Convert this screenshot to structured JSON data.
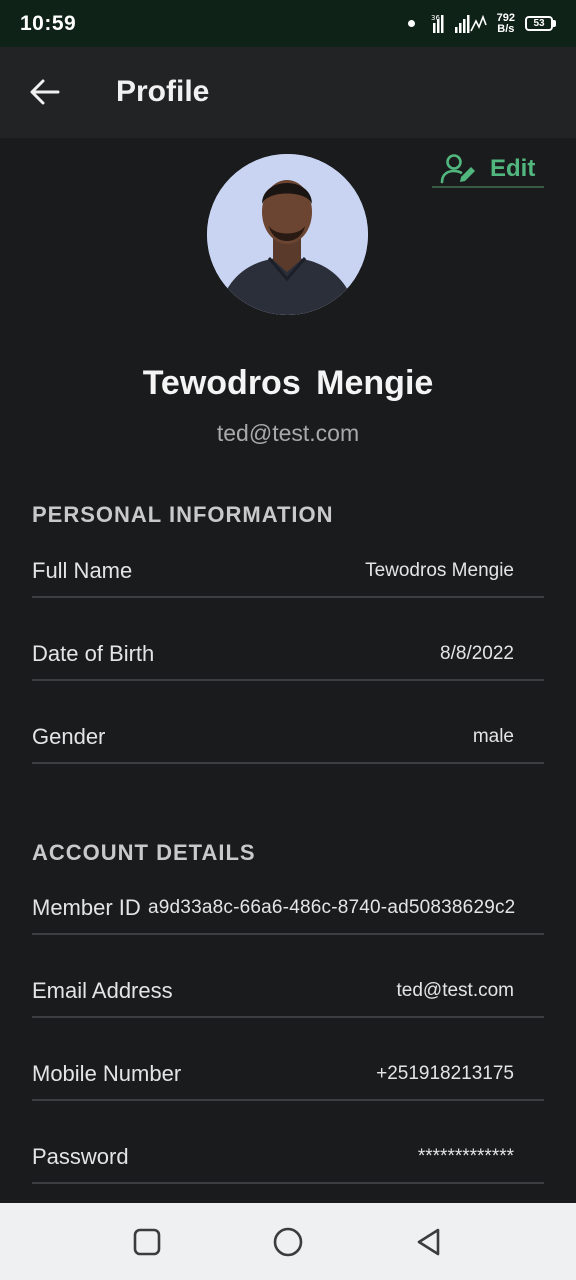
{
  "status_bar": {
    "time": "10:59",
    "net_speed_value": "792",
    "net_speed_unit": "B/s",
    "battery": "53",
    "icons": [
      "notification-dot-icon",
      "signal-icon",
      "wifi-off-icon",
      "battery-icon"
    ]
  },
  "app_bar": {
    "title": "Profile",
    "back_icon": "arrow-left-icon"
  },
  "profile": {
    "edit_label": "Edit",
    "edit_icon": "user-edit-icon",
    "accent_color": "#52b77e",
    "name": "Tewodros  Mengie",
    "email": "ted@test.com"
  },
  "personal_information": {
    "title": "PERSONAL INFORMATION",
    "rows": [
      {
        "label": "Full Name",
        "value": "Tewodros  Mengie"
      },
      {
        "label": "Date of Birth",
        "value": "8/8/2022"
      },
      {
        "label": "Gender",
        "value": "male"
      }
    ]
  },
  "account_details": {
    "title": "ACCOUNT DETAILS",
    "rows": [
      {
        "label": "Member ID",
        "value": "a9d33a8c-66a6-486c-8740-ad50838629c2"
      },
      {
        "label": "Email Address",
        "value": "ted@test.com"
      },
      {
        "label": "Mobile Number",
        "value": "+251918213175"
      },
      {
        "label": "Password",
        "value": "*************"
      }
    ]
  },
  "nav_bar": {
    "icons": [
      "recents-square-icon",
      "home-circle-icon",
      "back-triangle-icon"
    ]
  }
}
